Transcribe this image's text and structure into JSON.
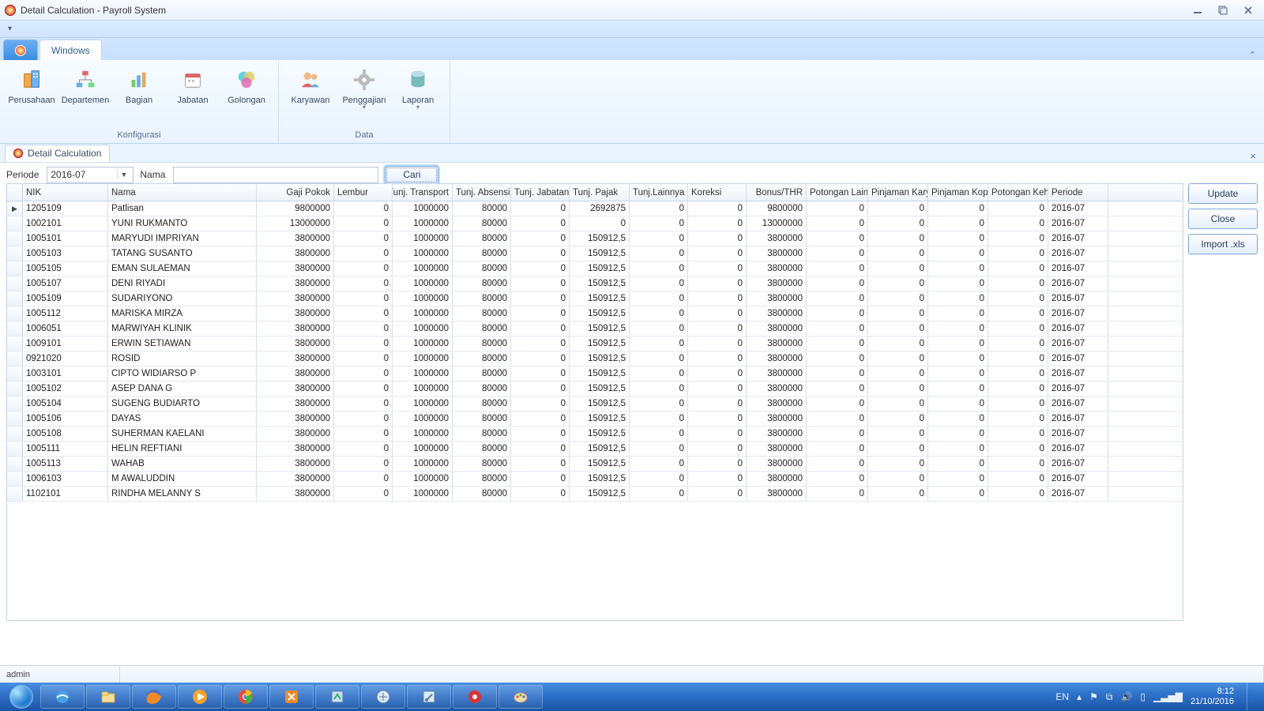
{
  "window": {
    "title": "Detail Calculation - Payroll System"
  },
  "ribbon": {
    "tabs": {
      "windows": "Windows"
    },
    "groups": {
      "konfigurasi": {
        "label": "Konfigurasi",
        "items": {
          "perusahaan": "Perusahaan",
          "departemen": "Departemen",
          "bagian": "Bagian",
          "jabatan": "Jabatan",
          "golongan": "Golongan"
        }
      },
      "data": {
        "label": "Data",
        "items": {
          "karyawan": "Karyawan",
          "penggajian": "Penggajian",
          "laporan": "Laporan"
        }
      }
    }
  },
  "doc_tab": {
    "label": "Detail Calculation"
  },
  "search": {
    "periode_label": "Periode",
    "periode_value": "2016-07",
    "nama_label": "Nama",
    "nama_value": "",
    "cari": "Cari"
  },
  "side": {
    "update": "Update",
    "close": "Close",
    "import": "Import .xls"
  },
  "columns": {
    "nik": "NIK",
    "nama": "Nama",
    "gaji": "Gaji Pokok",
    "lembur": "Lembur",
    "transport": "Tunj. Transport",
    "absen": "Tunj. Absensi",
    "jabatan": "Tunj. Jabatan",
    "pajak": "Tunj. Pajak",
    "lain": "Tunj.Lainnya",
    "koreksi": "Koreksi",
    "bonus": "Bonus/THR",
    "potlain": "Potongan Lainn",
    "pinjkar": "Pinjaman Karya",
    "pinjkop": "Pinjaman Kope",
    "pothadir": "Potongan Kehad",
    "periode": "Periode"
  },
  "rows": [
    {
      "nik": "1205109",
      "nama": "Patlisan",
      "gaji": "9800000",
      "lembur": "0",
      "transport": "1000000",
      "absen": "80000",
      "jabatan": "0",
      "pajak": "2692875",
      "lain": "0",
      "koreksi": "0",
      "bonus": "9800000",
      "potlain": "0",
      "pinjkar": "0",
      "pinjkop": "0",
      "pothadir": "0",
      "periode": "2016-07"
    },
    {
      "nik": "1002101",
      "nama": "YUNI RUKMANTO",
      "gaji": "13000000",
      "lembur": "0",
      "transport": "1000000",
      "absen": "80000",
      "jabatan": "0",
      "pajak": "0",
      "lain": "0",
      "koreksi": "0",
      "bonus": "13000000",
      "potlain": "0",
      "pinjkar": "0",
      "pinjkop": "0",
      "pothadir": "0",
      "periode": "2016-07"
    },
    {
      "nik": "1005101",
      "nama": "MARYUDI IMPRIYAN",
      "gaji": "3800000",
      "lembur": "0",
      "transport": "1000000",
      "absen": "80000",
      "jabatan": "0",
      "pajak": "150912,5",
      "lain": "0",
      "koreksi": "0",
      "bonus": "3800000",
      "potlain": "0",
      "pinjkar": "0",
      "pinjkop": "0",
      "pothadir": "0",
      "periode": "2016-07"
    },
    {
      "nik": "1005103",
      "nama": "TATANG SUSANTO",
      "gaji": "3800000",
      "lembur": "0",
      "transport": "1000000",
      "absen": "80000",
      "jabatan": "0",
      "pajak": "150912,5",
      "lain": "0",
      "koreksi": "0",
      "bonus": "3800000",
      "potlain": "0",
      "pinjkar": "0",
      "pinjkop": "0",
      "pothadir": "0",
      "periode": "2016-07"
    },
    {
      "nik": "1005105",
      "nama": "EMAN SULAEMAN",
      "gaji": "3800000",
      "lembur": "0",
      "transport": "1000000",
      "absen": "80000",
      "jabatan": "0",
      "pajak": "150912,5",
      "lain": "0",
      "koreksi": "0",
      "bonus": "3800000",
      "potlain": "0",
      "pinjkar": "0",
      "pinjkop": "0",
      "pothadir": "0",
      "periode": "2016-07"
    },
    {
      "nik": "1005107",
      "nama": "DENI RIYADI",
      "gaji": "3800000",
      "lembur": "0",
      "transport": "1000000",
      "absen": "80000",
      "jabatan": "0",
      "pajak": "150912,5",
      "lain": "0",
      "koreksi": "0",
      "bonus": "3800000",
      "potlain": "0",
      "pinjkar": "0",
      "pinjkop": "0",
      "pothadir": "0",
      "periode": "2016-07"
    },
    {
      "nik": "1005109",
      "nama": "SUDARIYONO",
      "gaji": "3800000",
      "lembur": "0",
      "transport": "1000000",
      "absen": "80000",
      "jabatan": "0",
      "pajak": "150912,5",
      "lain": "0",
      "koreksi": "0",
      "bonus": "3800000",
      "potlain": "0",
      "pinjkar": "0",
      "pinjkop": "0",
      "pothadir": "0",
      "periode": "2016-07"
    },
    {
      "nik": "1005112",
      "nama": "MARISKA  MIRZA",
      "gaji": "3800000",
      "lembur": "0",
      "transport": "1000000",
      "absen": "80000",
      "jabatan": "0",
      "pajak": "150912,5",
      "lain": "0",
      "koreksi": "0",
      "bonus": "3800000",
      "potlain": "0",
      "pinjkar": "0",
      "pinjkop": "0",
      "pothadir": "0",
      "periode": "2016-07"
    },
    {
      "nik": "1006051",
      "nama": "MARWIYAH KLINIK",
      "gaji": "3800000",
      "lembur": "0",
      "transport": "1000000",
      "absen": "80000",
      "jabatan": "0",
      "pajak": "150912,5",
      "lain": "0",
      "koreksi": "0",
      "bonus": "3800000",
      "potlain": "0",
      "pinjkar": "0",
      "pinjkop": "0",
      "pothadir": "0",
      "periode": "2016-07"
    },
    {
      "nik": "1009101",
      "nama": "ERWIN SETIAWAN",
      "gaji": "3800000",
      "lembur": "0",
      "transport": "1000000",
      "absen": "80000",
      "jabatan": "0",
      "pajak": "150912,5",
      "lain": "0",
      "koreksi": "0",
      "bonus": "3800000",
      "potlain": "0",
      "pinjkar": "0",
      "pinjkop": "0",
      "pothadir": "0",
      "periode": "2016-07"
    },
    {
      "nik": "0921020",
      "nama": "ROSID",
      "gaji": "3800000",
      "lembur": "0",
      "transport": "1000000",
      "absen": "80000",
      "jabatan": "0",
      "pajak": "150912,5",
      "lain": "0",
      "koreksi": "0",
      "bonus": "3800000",
      "potlain": "0",
      "pinjkar": "0",
      "pinjkop": "0",
      "pothadir": "0",
      "periode": "2016-07"
    },
    {
      "nik": "1003101",
      "nama": "CIPTO WIDIARSO P",
      "gaji": "3800000",
      "lembur": "0",
      "transport": "1000000",
      "absen": "80000",
      "jabatan": "0",
      "pajak": "150912,5",
      "lain": "0",
      "koreksi": "0",
      "bonus": "3800000",
      "potlain": "0",
      "pinjkar": "0",
      "pinjkop": "0",
      "pothadir": "0",
      "periode": "2016-07"
    },
    {
      "nik": "1005102",
      "nama": "ASEP DANA G",
      "gaji": "3800000",
      "lembur": "0",
      "transport": "1000000",
      "absen": "80000",
      "jabatan": "0",
      "pajak": "150912,5",
      "lain": "0",
      "koreksi": "0",
      "bonus": "3800000",
      "potlain": "0",
      "pinjkar": "0",
      "pinjkop": "0",
      "pothadir": "0",
      "periode": "2016-07"
    },
    {
      "nik": "1005104",
      "nama": "SUGENG BUDIARTO",
      "gaji": "3800000",
      "lembur": "0",
      "transport": "1000000",
      "absen": "80000",
      "jabatan": "0",
      "pajak": "150912,5",
      "lain": "0",
      "koreksi": "0",
      "bonus": "3800000",
      "potlain": "0",
      "pinjkar": "0",
      "pinjkop": "0",
      "pothadir": "0",
      "periode": "2016-07"
    },
    {
      "nik": "1005106",
      "nama": "DAYAS",
      "gaji": "3800000",
      "lembur": "0",
      "transport": "1000000",
      "absen": "80000",
      "jabatan": "0",
      "pajak": "150912,5",
      "lain": "0",
      "koreksi": "0",
      "bonus": "3800000",
      "potlain": "0",
      "pinjkar": "0",
      "pinjkop": "0",
      "pothadir": "0",
      "periode": "2016-07"
    },
    {
      "nik": "1005108",
      "nama": "SUHERMAN KAELANI",
      "gaji": "3800000",
      "lembur": "0",
      "transport": "1000000",
      "absen": "80000",
      "jabatan": "0",
      "pajak": "150912,5",
      "lain": "0",
      "koreksi": "0",
      "bonus": "3800000",
      "potlain": "0",
      "pinjkar": "0",
      "pinjkop": "0",
      "pothadir": "0",
      "periode": "2016-07"
    },
    {
      "nik": "1005111",
      "nama": "HELIN REFTIANI",
      "gaji": "3800000",
      "lembur": "0",
      "transport": "1000000",
      "absen": "80000",
      "jabatan": "0",
      "pajak": "150912,5",
      "lain": "0",
      "koreksi": "0",
      "bonus": "3800000",
      "potlain": "0",
      "pinjkar": "0",
      "pinjkop": "0",
      "pothadir": "0",
      "periode": "2016-07"
    },
    {
      "nik": "1005113",
      "nama": "WAHAB",
      "gaji": "3800000",
      "lembur": "0",
      "transport": "1000000",
      "absen": "80000",
      "jabatan": "0",
      "pajak": "150912,5",
      "lain": "0",
      "koreksi": "0",
      "bonus": "3800000",
      "potlain": "0",
      "pinjkar": "0",
      "pinjkop": "0",
      "pothadir": "0",
      "periode": "2016-07"
    },
    {
      "nik": "1006103",
      "nama": "M AWALUDDIN",
      "gaji": "3800000",
      "lembur": "0",
      "transport": "1000000",
      "absen": "80000",
      "jabatan": "0",
      "pajak": "150912,5",
      "lain": "0",
      "koreksi": "0",
      "bonus": "3800000",
      "potlain": "0",
      "pinjkar": "0",
      "pinjkop": "0",
      "pothadir": "0",
      "periode": "2016-07"
    },
    {
      "nik": "1102101",
      "nama": "RINDHA MELANNY S",
      "gaji": "3800000",
      "lembur": "0",
      "transport": "1000000",
      "absen": "80000",
      "jabatan": "0",
      "pajak": "150912,5",
      "lain": "0",
      "koreksi": "0",
      "bonus": "3800000",
      "potlain": "0",
      "pinjkar": "0",
      "pinjkop": "0",
      "pothadir": "0",
      "periode": "2016-07"
    }
  ],
  "status": {
    "user": "admin"
  },
  "tray": {
    "lang": "EN",
    "time": "8:12",
    "date": "21/10/2016"
  }
}
